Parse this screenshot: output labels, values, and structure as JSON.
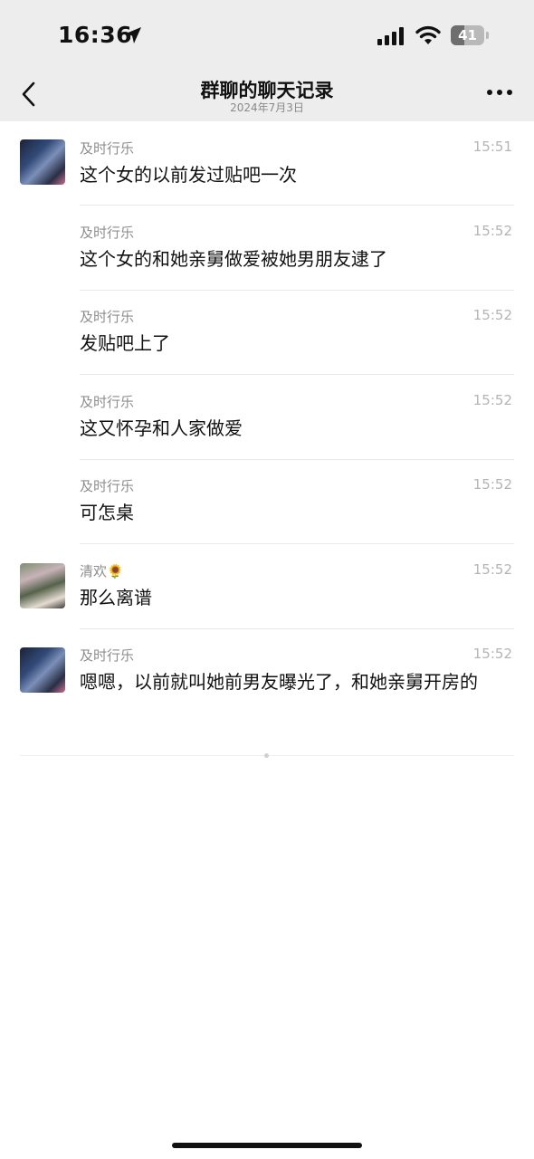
{
  "status": {
    "time": "16:36",
    "battery": "41",
    "battery_level": 0.41
  },
  "nav": {
    "title": "群聊的聊天记录",
    "date": "2024年7月3日",
    "back_icon": "chevron-left-icon",
    "more_icon": "more-icon"
  },
  "messages": [
    {
      "sender": "及时行乐",
      "time": "15:51",
      "text": "这个女的以前发过贴吧一次",
      "avatar": true
    },
    {
      "sender": "及时行乐",
      "time": "15:52",
      "text": "这个女的和她亲舅做爱被她男朋友逮了",
      "avatar": false
    },
    {
      "sender": "及时行乐",
      "time": "15:52",
      "text": "发贴吧上了",
      "avatar": false
    },
    {
      "sender": "及时行乐",
      "time": "15:52",
      "text": "这又怀孕和人家做爱",
      "avatar": false
    },
    {
      "sender": "及时行乐",
      "time": "15:52",
      "text": "可怎桌",
      "avatar": false
    },
    {
      "sender": "清欢🌻",
      "time": "15:52",
      "text": "那么离谱",
      "avatar": true
    },
    {
      "sender": "及时行乐",
      "time": "15:52",
      "text": "嗯嗯，以前就叫她前男友曝光了，和她亲舅开房的",
      "avatar": true
    }
  ]
}
